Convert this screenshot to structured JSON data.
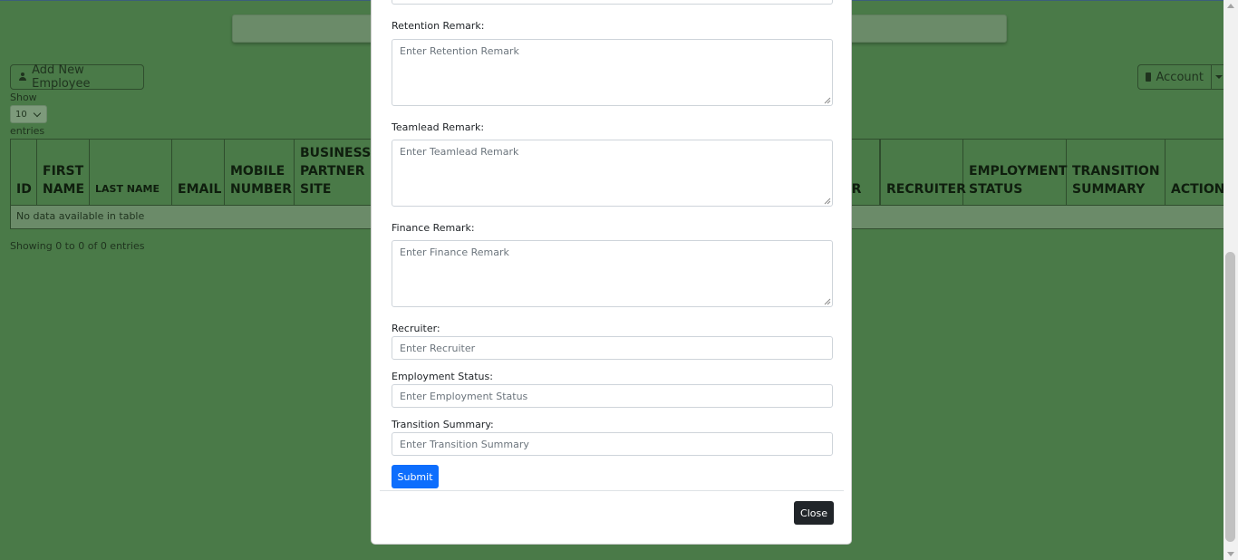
{
  "toolbar": {
    "add_employee_label": "Add New Employee",
    "account_label": "Account"
  },
  "table_controls": {
    "show_label": "Show",
    "page_length": "10",
    "entries_label": "entries"
  },
  "table": {
    "headers": [
      "ID",
      "FIRST NAME",
      "LAST NAME",
      "EMAIL",
      "MOBILE NUMBER",
      "BUSINESS PARTNER SITE",
      "ER",
      "RECRUITER",
      "EMPLOYMENT STATUS",
      "TRANSITION SUMMARY",
      "ACTION"
    ],
    "empty_message": "No data available in table",
    "info": "Showing 0 to 0 of 0 entries"
  },
  "modal": {
    "fields": {
      "retention": {
        "label": "Retention Remark:",
        "placeholder": "Enter Retention Remark"
      },
      "teamlead": {
        "label": "Teamlead Remark:",
        "placeholder": "Enter Teamlead Remark"
      },
      "finance": {
        "label": "Finance Remark:",
        "placeholder": "Enter Finance Remark"
      },
      "recruiter": {
        "label": "Recruiter:",
        "placeholder": "Enter Recruiter"
      },
      "employment_status": {
        "label": "Employment Status:",
        "placeholder": "Enter Employment Status"
      },
      "transition_summary": {
        "label": "Transition Summary:",
        "placeholder": "Enter Transition Summary"
      }
    },
    "submit_label": "Submit",
    "close_label": "Close"
  },
  "colors": {
    "backdrop": "#4a7a48",
    "primary": "#0d6efd",
    "dark": "#212529"
  }
}
